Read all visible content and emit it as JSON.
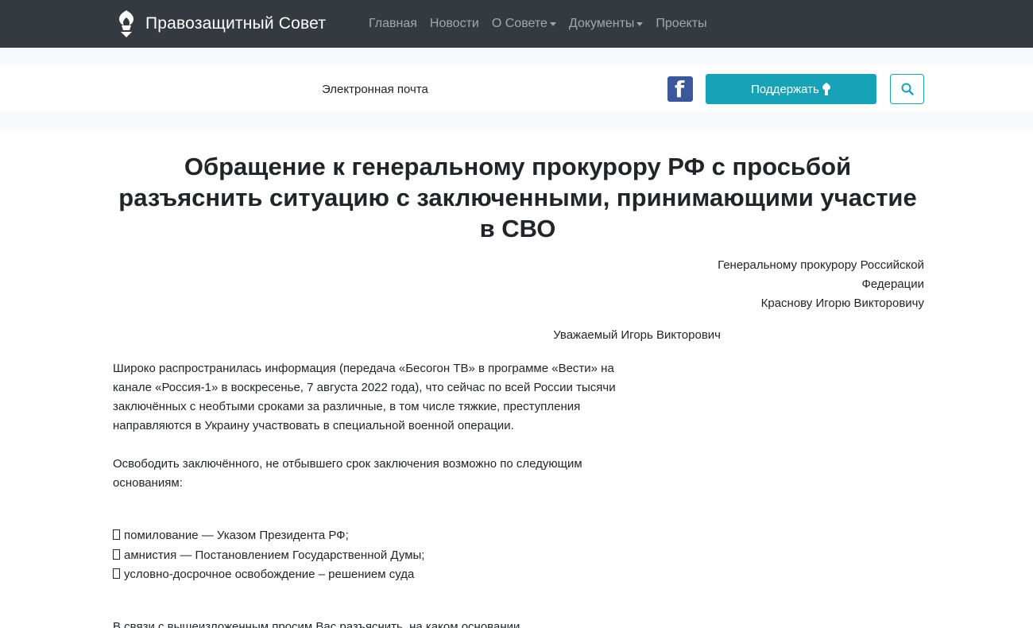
{
  "navbar": {
    "brand": "Правозащитный Совет",
    "items": [
      {
        "label": "Главная",
        "dropdown": false
      },
      {
        "label": "Новости",
        "dropdown": false
      },
      {
        "label": "О Совете",
        "dropdown": true
      },
      {
        "label": "Документы",
        "dropdown": true
      },
      {
        "label": "Проекты",
        "dropdown": false
      }
    ]
  },
  "secondary_bar": {
    "email_label": "Электронная почта",
    "facebook_icon": "facebook-icon",
    "support_label": "Поддержать",
    "search_icon": "search-icon"
  },
  "article": {
    "title": "Обращение к генеральному прокурору РФ с просьбой разъяснить ситуацию с заключенными, принимающими участие в СВО",
    "addressee": [
      "Генеральному прокурору Российской",
      "Федерации",
      "Краснову Игорю Викторовичу"
    ],
    "salutation": "Уважаемый Игорь Викторович",
    "paragraph1": "Широко распространилась информация (передача «Бесогон ТВ» в программе «Вести» на канале «Россия-1» в воскресенье, 7 августа 2022 года), что сейчас по всей России тысячи заключённых с необтыми сроками за различные, в том числе тяжкие, преступления направляются в Украину участвовать в специальной военной операции.",
    "paragraph2": "Освободить заключённого, не отбывшего срок заключения возможно по следующим основаниям:",
    "list": [
      "помилование — Указом Президента РФ;",
      "амнистия — Постановлением Государственной Думы;",
      "условно-досрочное освобождение – решением суда"
    ],
    "paragraph3": "В связи с вышеизложенным просим Вас разъяснить, на каком основании"
  },
  "colors": {
    "navbar_bg": "#343a40",
    "accent": "#17a2b8",
    "facebook": "#3b5998"
  }
}
